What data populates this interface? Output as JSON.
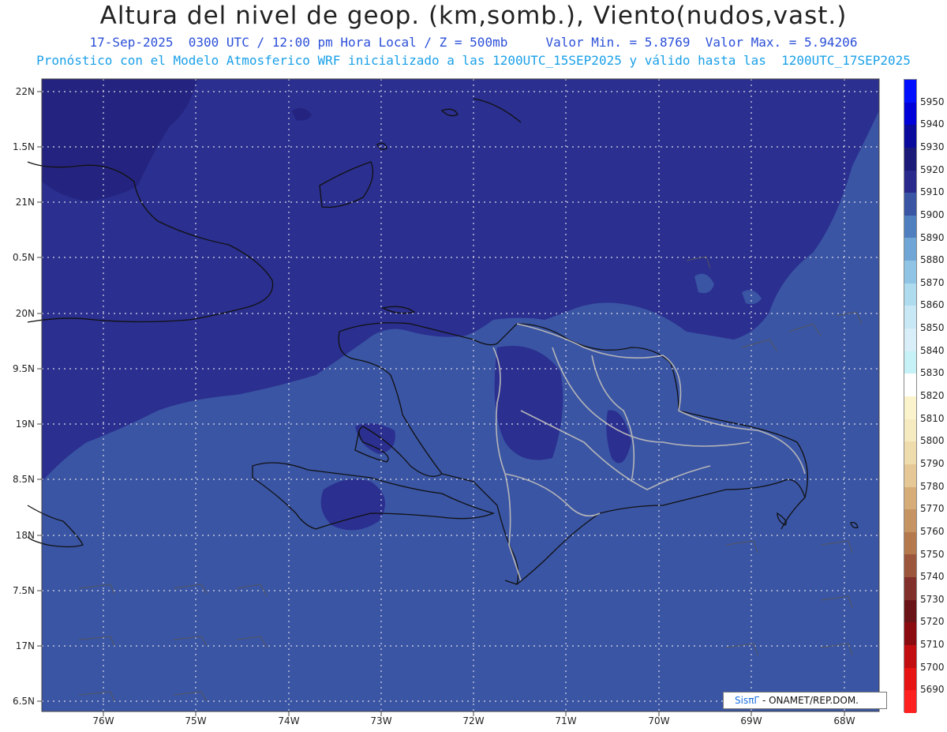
{
  "header": {
    "title": "Altura del nivel de geop. (km,somb.), Viento(nudos,vast.)",
    "line1": "17-Sep-2025  0300 UTC / 12:00 pm Hora Local / Z = 500mb     Valor Min. = 5.8769  Valor Max. = 5.94206",
    "line2": "Pronóstico con el Modelo Atmosferico WRF inicializado a las 1200UTC_15SEP2025 y válido hasta las  1200UTC_17SEP2025"
  },
  "map": {
    "lat_labels": [
      "22N",
      "1.5N",
      "21N",
      "0.5N",
      "20N",
      "9.5N",
      "19N",
      "8.5N",
      "18N",
      "7.5N",
      "17N",
      "6.5N"
    ],
    "lon_labels": [
      "76W",
      "75W",
      "74W",
      "73W",
      "72W",
      "71W",
      "70W",
      "69W",
      "68W"
    ],
    "fill_colors": {
      "level_5900": "#3a55a4",
      "level_5910": "#2b2f8f",
      "level_5920": "#242480"
    }
  },
  "colorbar": {
    "labels": [
      "5950",
      "5940",
      "5930",
      "5920",
      "5910",
      "5900",
      "5890",
      "5880",
      "5870",
      "5860",
      "5850",
      "5840",
      "5830",
      "5820",
      "5810",
      "5800",
      "5790",
      "5780",
      "5770",
      "5760",
      "5750",
      "5740",
      "5730",
      "5720",
      "5710",
      "5700",
      "5690"
    ],
    "colors": [
      "#0010ff",
      "#0000d8",
      "#0a0a9c",
      "#1b1a78",
      "#2a2a8c",
      "#3a55a4",
      "#4f7fbe",
      "#6fa6d6",
      "#8fc4e4",
      "#aedcee",
      "#c7e8f4",
      "#d8eef8",
      "#c5f1f7",
      "#ffffff",
      "#fbf3cc",
      "#f6eac0",
      "#efdcac",
      "#e6c896",
      "#d6ad78",
      "#c59462",
      "#b47a4e",
      "#9c563c",
      "#82302c",
      "#6a1418",
      "#8a0c10",
      "#c20e10",
      "#e81414",
      "#ff2020"
    ]
  },
  "credit": {
    "brand": "SisπΓ",
    "text": "- ONAMET/REP.DOM."
  }
}
